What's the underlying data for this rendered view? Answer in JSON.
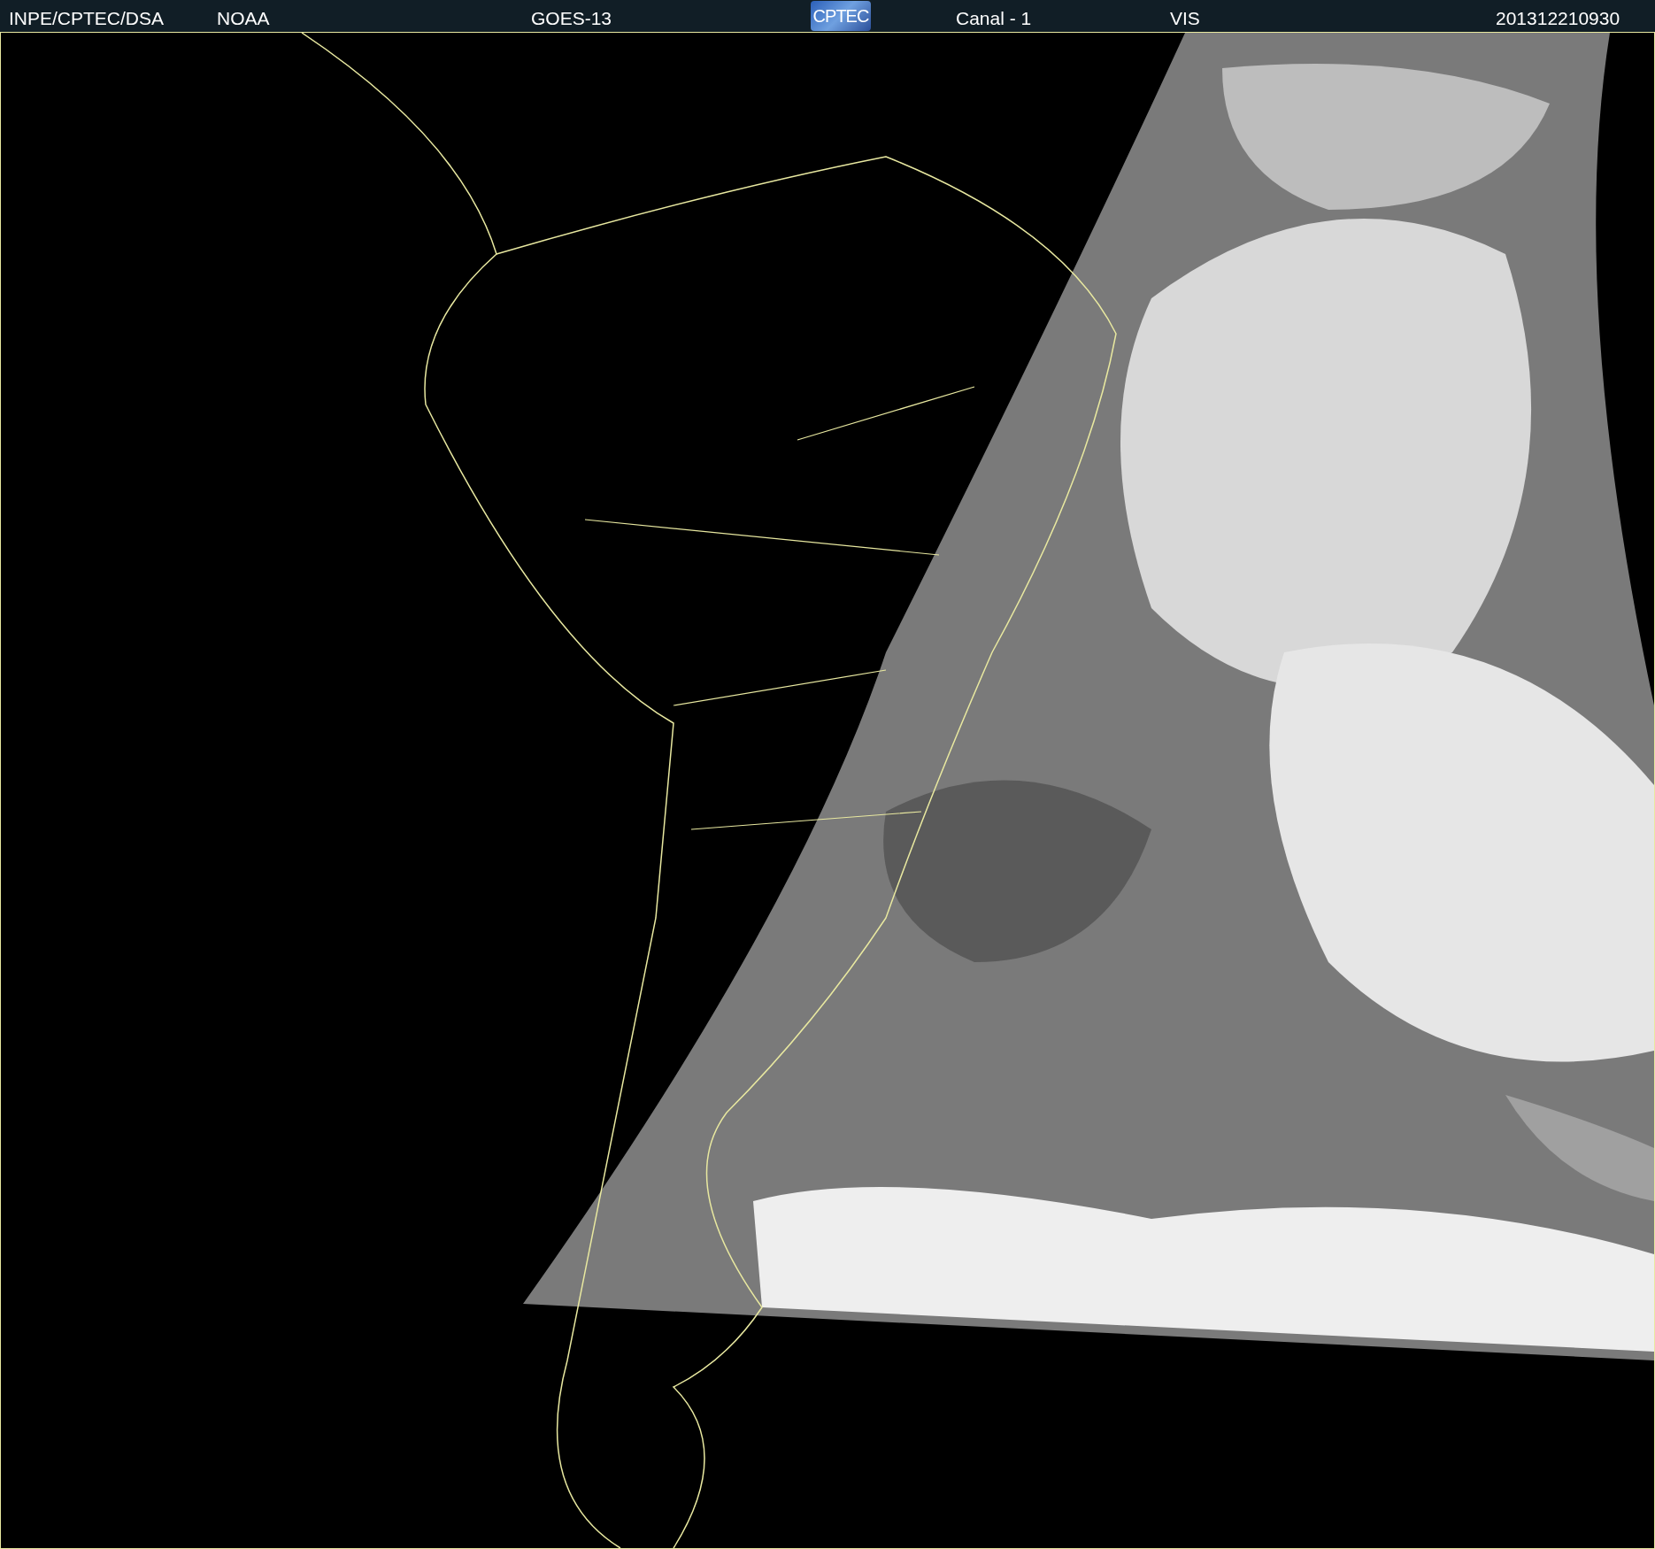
{
  "header": {
    "items": [
      {
        "kind": "text",
        "text": "INPE/CPTEC/DSA"
      },
      {
        "kind": "text",
        "text": "NOAA"
      },
      {
        "kind": "text",
        "text": "GOES-13"
      },
      {
        "kind": "logo",
        "text": "CPTEC"
      },
      {
        "kind": "text",
        "text": "Canal - 1"
      },
      {
        "kind": "text",
        "text": "VIS"
      },
      {
        "kind": "text",
        "text": "201312210930"
      }
    ]
  }
}
